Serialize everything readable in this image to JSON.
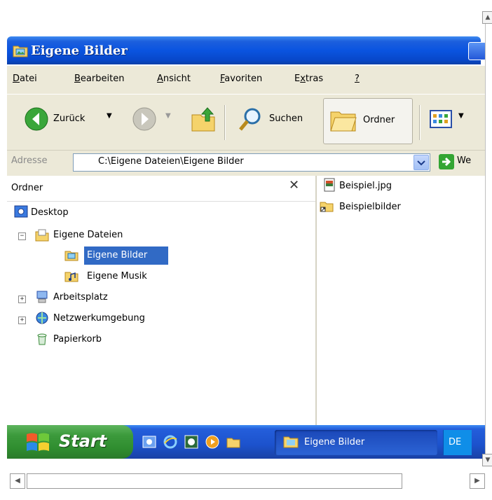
{
  "window": {
    "title": "Eigene Bilder",
    "titlebar_color": "#0a54e0"
  },
  "menu": {
    "items": [
      {
        "label": "Datei",
        "underline": "D"
      },
      {
        "label": "Bearbeiten",
        "underline": "B"
      },
      {
        "label": "Ansicht",
        "underline": "A"
      },
      {
        "label": "Favoriten",
        "underline": "F"
      },
      {
        "label": "Extras",
        "underline": "x"
      },
      {
        "label": "?",
        "underline": "?"
      }
    ]
  },
  "toolbar": {
    "back_label": "Zurück",
    "search_label": "Suchen",
    "folders_label": "Ordner",
    "icons": [
      "back-arrow-icon",
      "forward-arrow-icon",
      "folder-up-icon",
      "search-icon",
      "folders-icon",
      "views-icon"
    ]
  },
  "address": {
    "label": "Adresse",
    "value": "C:\\Eigene Dateien\\Eigene Bilder",
    "go_label": "We"
  },
  "folder_pane": {
    "title": "Ordner",
    "close_glyph": "✕",
    "tree": [
      {
        "label": "Desktop",
        "icon": "desktop-icon",
        "expander": ""
      },
      {
        "label": "Eigene Dateien",
        "icon": "my-documents-icon",
        "expander": "−"
      },
      {
        "label": "Eigene Bilder",
        "icon": "my-pictures-icon",
        "expander": "",
        "selected": true
      },
      {
        "label": "Eigene Musik",
        "icon": "my-music-icon",
        "expander": ""
      },
      {
        "label": "Arbeitsplatz",
        "icon": "my-computer-icon",
        "expander": "+"
      },
      {
        "label": "Netzwerkumgebung",
        "icon": "network-icon",
        "expander": "+"
      },
      {
        "label": "Papierkorb",
        "icon": "recycle-bin-icon",
        "expander": ""
      }
    ]
  },
  "files": [
    {
      "name": "Beispiel.jpg",
      "icon": "image-file-icon"
    },
    {
      "name": "Beispielbilder",
      "icon": "folder-shortcut-icon"
    }
  ],
  "taskbar": {
    "start_label": "Start",
    "task_label": "Eigene Bilder",
    "language": "DE",
    "quick_launch": [
      "desktop-icon",
      "ie-icon",
      "media-icon",
      "player-icon",
      "folder-icon"
    ]
  }
}
